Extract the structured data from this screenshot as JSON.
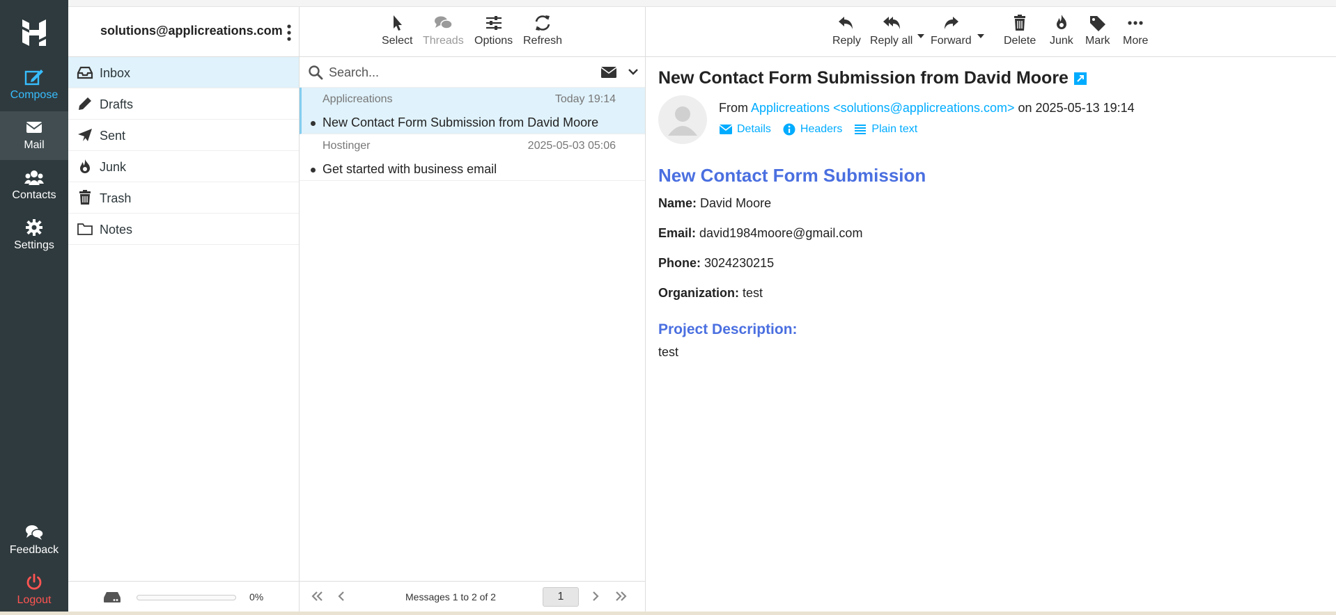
{
  "rail": {
    "items": [
      {
        "label": "Compose",
        "icon": "compose-icon"
      },
      {
        "label": "Mail",
        "icon": "mail-icon"
      },
      {
        "label": "Contacts",
        "icon": "contacts-icon"
      },
      {
        "label": "Settings",
        "icon": "gear-icon"
      },
      {
        "label": "Feedback",
        "icon": "feedback-icon"
      },
      {
        "label": "Logout",
        "icon": "power-icon"
      }
    ],
    "colors": {
      "background": "#2f3a3e",
      "active": "#414d51",
      "compose": "#37beff",
      "logout": "#ff5552"
    }
  },
  "account": {
    "email": "solutions@applicreations.com"
  },
  "folders": [
    {
      "label": "Inbox",
      "icon": "inbox-icon",
      "active": true
    },
    {
      "label": "Drafts",
      "icon": "pencil-icon"
    },
    {
      "label": "Sent",
      "icon": "paper-plane-icon"
    },
    {
      "label": "Junk",
      "icon": "fire-icon"
    },
    {
      "label": "Trash",
      "icon": "trash-icon"
    },
    {
      "label": "Notes",
      "icon": "folder-icon"
    }
  ],
  "quota": {
    "percent_label": "0%",
    "fraction": 0.0
  },
  "list_toolbar": {
    "select": "Select",
    "threads": "Threads",
    "options": "Options",
    "refresh": "Refresh"
  },
  "search": {
    "placeholder": "Search..."
  },
  "messages": [
    {
      "from": "Applicreations",
      "date": "Today 19:14",
      "subject": "New Contact Form Submission from David Moore",
      "selected": true
    },
    {
      "from": "Hostinger",
      "date": "2025-05-03 05:06",
      "subject": "Get started with business email"
    }
  ],
  "pager": {
    "count": "Messages 1 to 2 of 2",
    "page": "1"
  },
  "content_toolbar": {
    "reply": "Reply",
    "reply_all": "Reply all",
    "forward": "Forward",
    "delete": "Delete",
    "junk": "Junk",
    "mark": "Mark",
    "more": "More"
  },
  "message": {
    "subject": "New Contact Form Submission from David Moore",
    "from_prefix": "From",
    "from_link": "Applicreations <solutions@applicreations.com>",
    "date_text": "on 2025-05-13 19:14",
    "links": {
      "details": "Details",
      "headers": "Headers",
      "plain": "Plain text"
    },
    "body": {
      "heading": "New Contact Form Submission",
      "name_label": "Name:",
      "name": "David Moore",
      "email_label": "Email:",
      "email": "david1984moore@gmail.com",
      "phone_label": "Phone:",
      "phone": "3024230215",
      "org_label": "Organization:",
      "org": "test",
      "desc_heading": "Project Description:",
      "desc": "test"
    }
  },
  "accent": "#00acff"
}
